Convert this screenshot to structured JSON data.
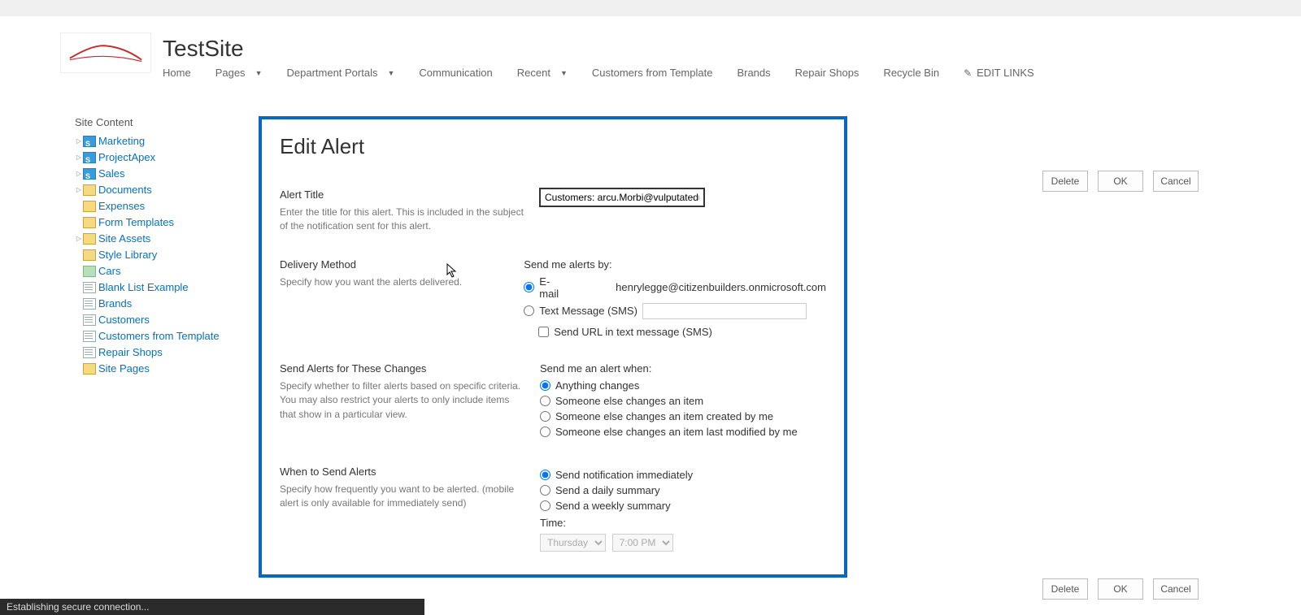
{
  "site": {
    "title": "TestSite"
  },
  "topnav": {
    "home": "Home",
    "pages": "Pages",
    "dept": "Department Portals",
    "comm": "Communication",
    "recent": "Recent",
    "cft": "Customers from Template",
    "brands": "Brands",
    "repair": "Repair Shops",
    "recycle": "Recycle Bin",
    "edit_links": "EDIT LINKS"
  },
  "tree": {
    "title": "Site Content",
    "items": [
      {
        "label": "Marketing",
        "icon": "site",
        "expander": true
      },
      {
        "label": "ProjectApex",
        "icon": "site",
        "expander": true
      },
      {
        "label": "Sales",
        "icon": "site",
        "expander": true
      },
      {
        "label": "Documents",
        "icon": "folder",
        "expander": true
      },
      {
        "label": "Expenses",
        "icon": "folder",
        "expander": false,
        "indent": 1
      },
      {
        "label": "Form Templates",
        "icon": "folder",
        "expander": false,
        "indent": 1
      },
      {
        "label": "Site Assets",
        "icon": "folder",
        "expander": true
      },
      {
        "label": "Style Library",
        "icon": "folder",
        "expander": false,
        "indent": 1
      },
      {
        "label": "Cars",
        "icon": "pic",
        "expander": false,
        "indent": 1
      },
      {
        "label": "Blank List Example",
        "icon": "list",
        "expander": false,
        "indent": 1
      },
      {
        "label": "Brands",
        "icon": "list",
        "expander": false,
        "indent": 1
      },
      {
        "label": "Customers",
        "icon": "list",
        "expander": false,
        "indent": 1
      },
      {
        "label": "Customers from Template",
        "icon": "list",
        "expander": false,
        "indent": 1
      },
      {
        "label": "Repair Shops",
        "icon": "list",
        "expander": false,
        "indent": 1
      },
      {
        "label": "Site Pages",
        "icon": "lib",
        "expander": false,
        "indent": 1
      }
    ]
  },
  "form": {
    "title": "Edit Alert",
    "alert_title": {
      "head": "Alert Title",
      "desc": "Enter the title for this alert. This is included in the subject of the notification sent for this alert.",
      "value": "Customers: arcu.Morbi@vulputateduinec."
    },
    "delivery": {
      "head": "Delivery Method",
      "desc": "Specify how you want the alerts delivered.",
      "q": "Send me alerts by:",
      "email_label": "E-mail",
      "email_value": "henrylegge@citizenbuilders.onmicrosoft.com",
      "sms_label": "Text Message (SMS)",
      "sms_check": "Send URL in text message (SMS)"
    },
    "changes": {
      "head": "Send Alerts for These Changes",
      "desc": "Specify whether to filter alerts based on specific criteria. You may also restrict your alerts to only include items that show in a particular view.",
      "q": "Send me an alert when:",
      "opt1": "Anything changes",
      "opt2": "Someone else changes an item",
      "opt3": "Someone else changes an item created by me",
      "opt4": "Someone else changes an item last modified by me"
    },
    "when": {
      "head": "When to Send Alerts",
      "desc": "Specify how frequently you want to be alerted. (mobile alert is only available for immediately send)",
      "opt1": "Send notification immediately",
      "opt2": "Send a daily summary",
      "opt3": "Send a weekly summary",
      "time_label": "Time:",
      "day": "Thursday",
      "hour": "7:00 PM"
    }
  },
  "buttons": {
    "delete": "Delete",
    "ok": "OK",
    "cancel": "Cancel"
  },
  "status": "Establishing secure connection..."
}
